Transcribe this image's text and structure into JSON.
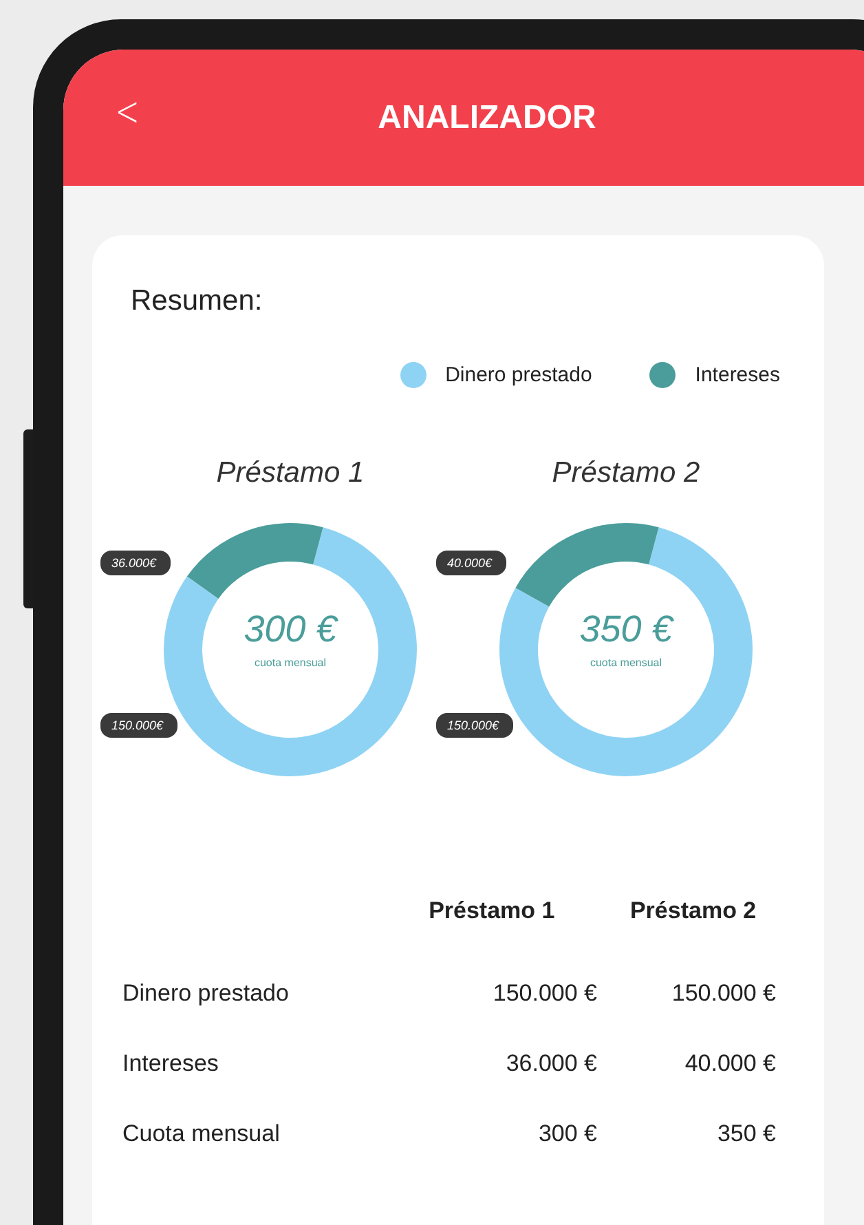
{
  "header": {
    "title": "ANALIZADOR",
    "back_icon": "<"
  },
  "summary": {
    "title": "Resumen:",
    "legend": [
      {
        "label": "Dinero prestado",
        "color": "#8fd3f4"
      },
      {
        "label": "Intereses",
        "color": "#4a9d9a"
      }
    ],
    "loans": [
      {
        "center_value": "300 €",
        "center_caption": "cuota mensual",
        "chart_data": {
          "type": "donut",
          "title": "Préstamo 1",
          "values": [
            150000,
            36000
          ],
          "value_labels": [
            "150.000€",
            "36.000€"
          ]
        }
      },
      {
        "center_value": "350 €",
        "center_caption": "cuota mensual",
        "chart_data": {
          "type": "donut",
          "title": "Préstamo 2",
          "values": [
            150000,
            40000
          ],
          "value_labels": [
            "150.000€",
            "40.000€"
          ]
        }
      }
    ]
  },
  "table": {
    "columns": [
      "Préstamo 1",
      "Préstamo 2"
    ],
    "rows": [
      {
        "label": "Dinero prestado",
        "values": [
          "150.000 €",
          "150.000 €"
        ]
      },
      {
        "label": "Intereses",
        "values": [
          "36.000 €",
          "40.000 €"
        ]
      },
      {
        "label": "Cuota mensual",
        "values": [
          "300 €",
          "350 €"
        ]
      }
    ]
  }
}
